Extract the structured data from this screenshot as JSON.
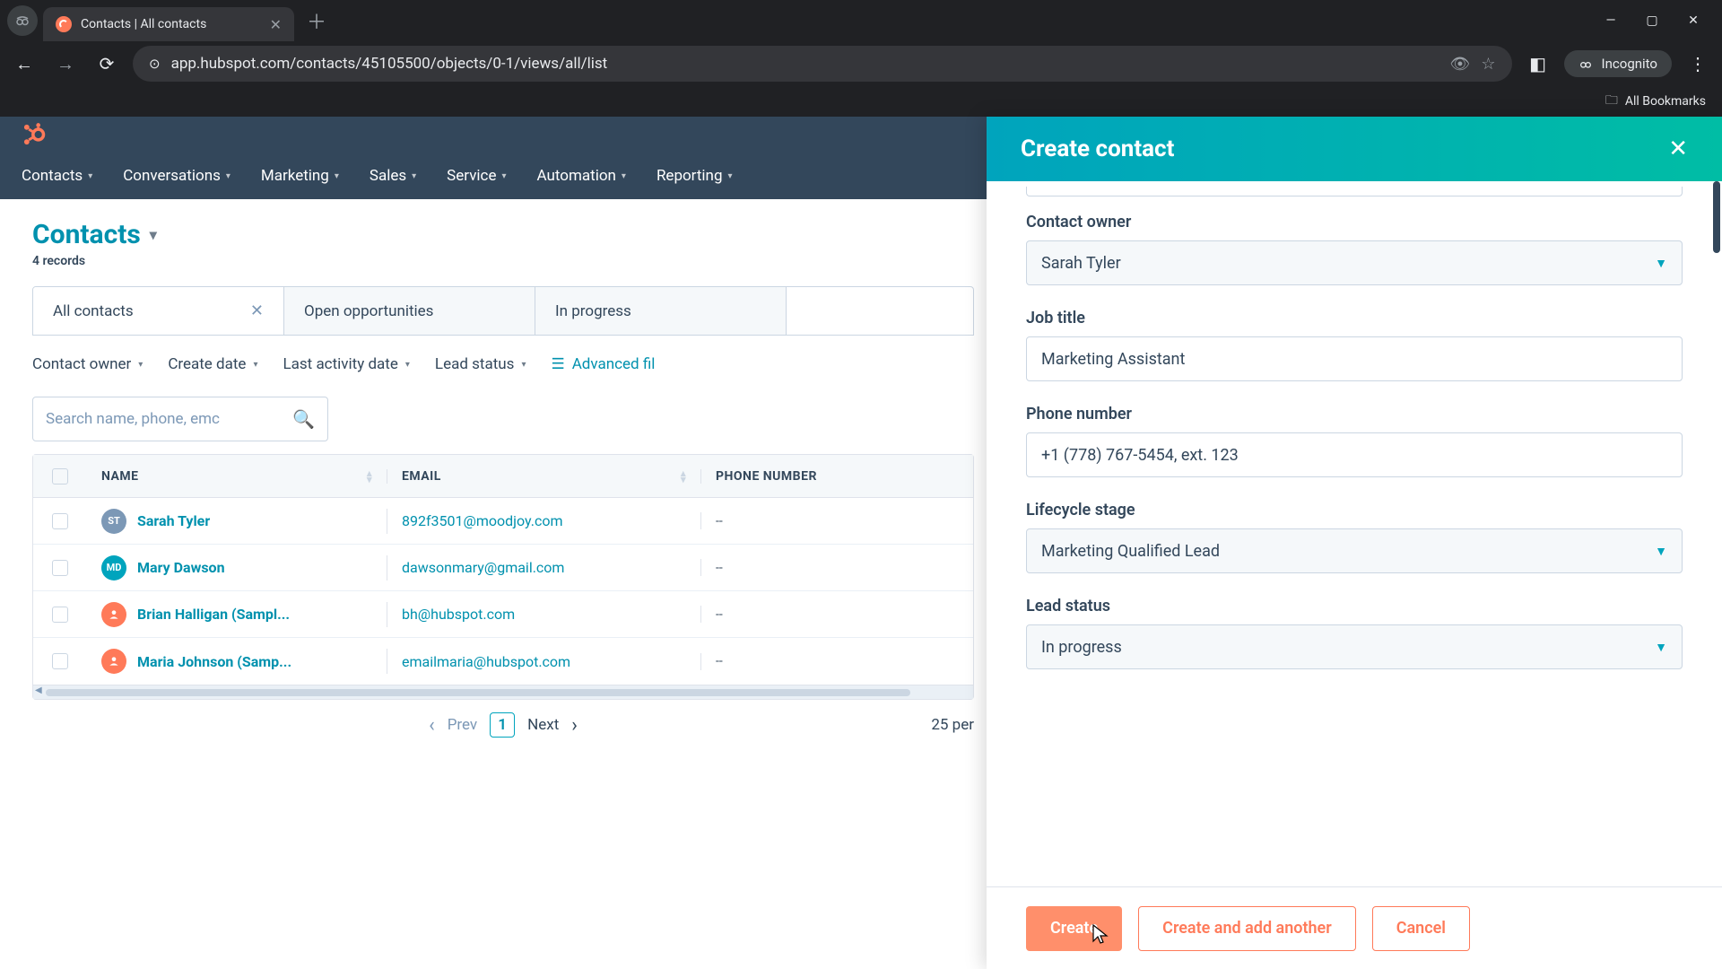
{
  "browser": {
    "tab_title": "Contacts | All contacts",
    "url": "app.hubspot.com/contacts/45105500/objects/0-1/views/all/list",
    "incognito_label": "Incognito",
    "bookmarks_label": "All Bookmarks"
  },
  "nav": {
    "items": [
      "Contacts",
      "Conversations",
      "Marketing",
      "Sales",
      "Service",
      "Automation",
      "Reporting"
    ]
  },
  "page": {
    "title": "Contacts",
    "records": "4 records",
    "tabs": [
      {
        "label": "All contacts",
        "closable": true,
        "active": true
      },
      {
        "label": "Open opportunities",
        "closable": false,
        "active": false
      },
      {
        "label": "In progress",
        "closable": false,
        "active": false
      }
    ],
    "filters": [
      "Contact owner",
      "Create date",
      "Last activity date",
      "Lead status"
    ],
    "advanced": "Advanced fil",
    "search_placeholder": "Search name, phone, emc"
  },
  "table": {
    "columns": [
      "NAME",
      "EMAIL",
      "PHONE NUMBER"
    ],
    "rows": [
      {
        "initials": "ST",
        "avatar_class": "av-purple",
        "name": "Sarah Tyler",
        "email": "892f3501@moodjoy.com",
        "phone": "--"
      },
      {
        "initials": "MD",
        "avatar_class": "av-teal",
        "name": "Mary Dawson",
        "email": "dawsonmary@gmail.com",
        "phone": "--"
      },
      {
        "initials": "",
        "avatar_class": "av-orange",
        "name": "Brian Halligan (Sampl...",
        "email": "bh@hubspot.com",
        "phone": "--"
      },
      {
        "initials": "",
        "avatar_class": "av-orange",
        "name": "Maria Johnson (Samp...",
        "email": "emailmaria@hubspot.com",
        "phone": "--"
      }
    ]
  },
  "pager": {
    "prev": "Prev",
    "page": "1",
    "next": "Next",
    "per_page": "25 per"
  },
  "panel": {
    "title": "Create contact",
    "fields": {
      "contact_owner": {
        "label": "Contact owner",
        "value": "Sarah Tyler"
      },
      "job_title": {
        "label": "Job title",
        "value": "Marketing Assistant"
      },
      "phone": {
        "label": "Phone number",
        "value": "+1 (778) 767-5454, ext. 123"
      },
      "lifecycle": {
        "label": "Lifecycle stage",
        "value": "Marketing Qualified Lead"
      },
      "lead_status": {
        "label": "Lead status",
        "value": "In progress"
      }
    },
    "buttons": {
      "create": "Create",
      "create_another": "Create and add another",
      "cancel": "Cancel"
    }
  }
}
